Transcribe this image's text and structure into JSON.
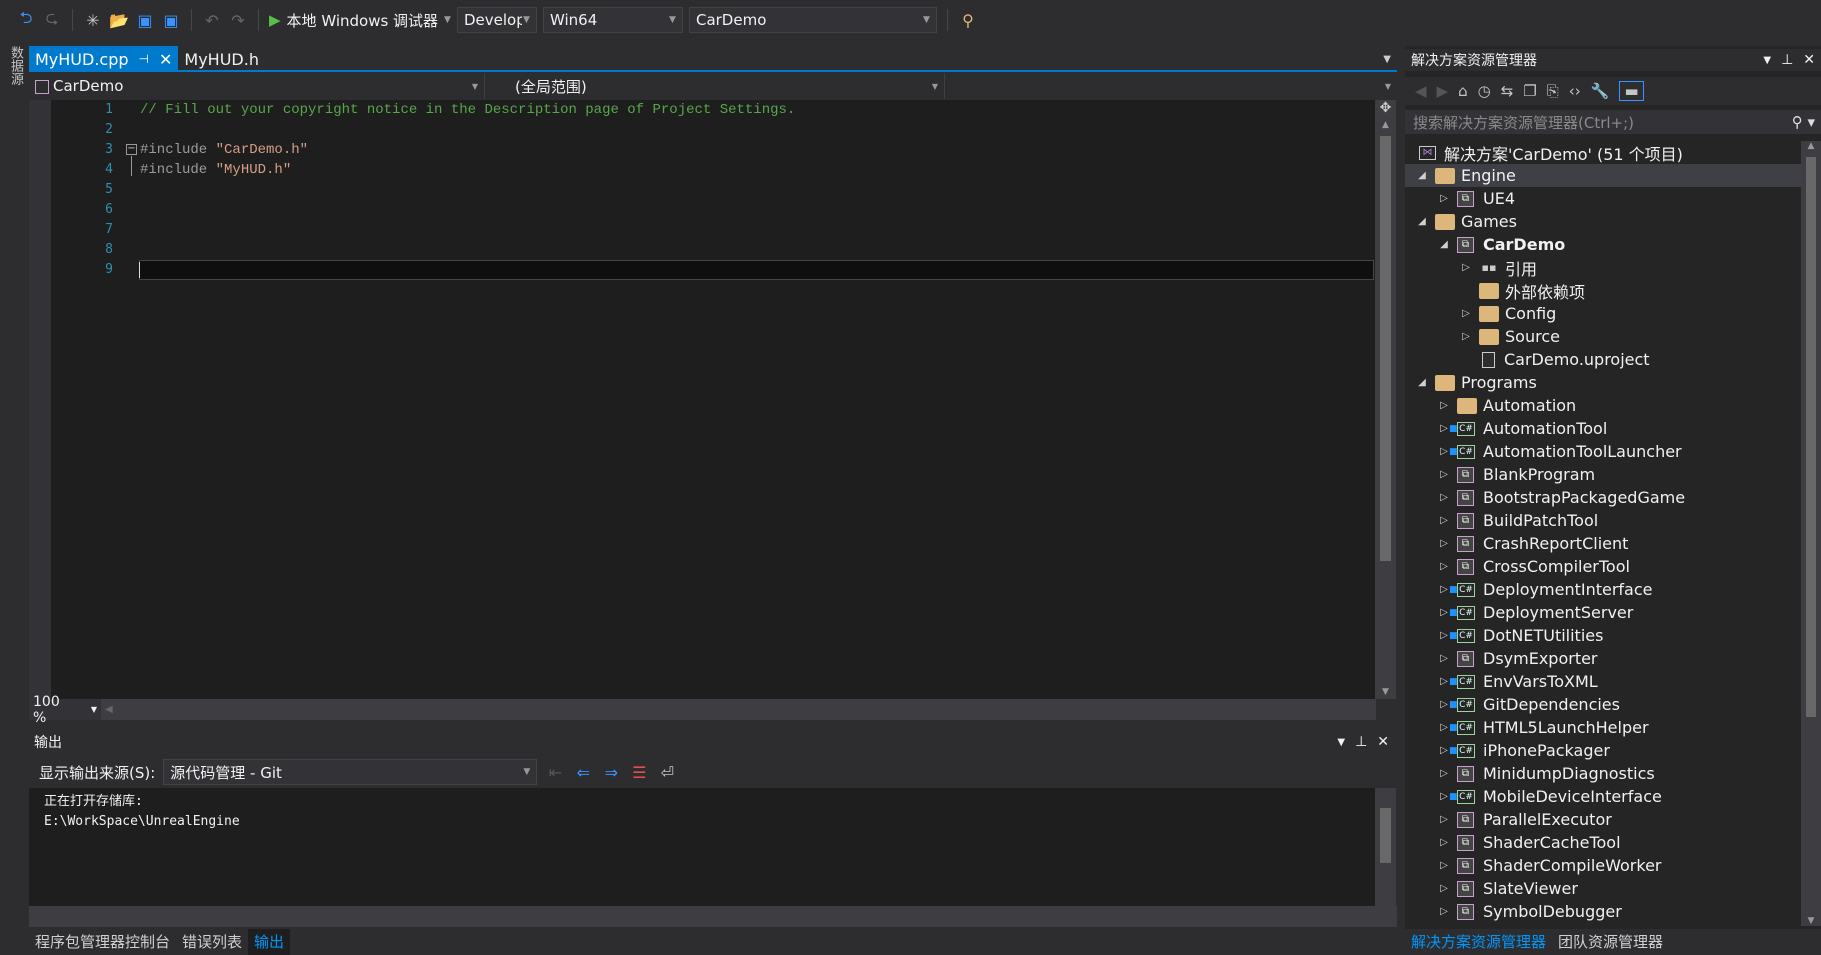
{
  "toolbar": {
    "debugger": "本地 Windows 调试器",
    "config": "Develop",
    "platform": "Win64",
    "project": "CarDemo"
  },
  "side_strip": {
    "label": "数据源"
  },
  "tabs": [
    {
      "label": "MyHUD.cpp",
      "active": true
    },
    {
      "label": "MyHUD.h",
      "active": false
    }
  ],
  "navbar": {
    "project": "CarDemo",
    "scope": "(全局范围)"
  },
  "editor": {
    "line_numbers": [
      "1",
      "2",
      "3",
      "4",
      "5",
      "6",
      "7",
      "8",
      "9"
    ],
    "lines": [
      {
        "type": "comment",
        "text": "// Fill out your copyright notice in the Description page of Project Settings."
      },
      {
        "type": "blank",
        "text": ""
      },
      {
        "type": "include",
        "directive": "#include",
        "file": "\"CarDemo.h\""
      },
      {
        "type": "include",
        "directive": "#include",
        "file": "\"MyHUD.h\""
      }
    ],
    "zoom": "100 %",
    "current_line": 9
  },
  "output": {
    "title": "输出",
    "source_label": "显示输出来源(S):",
    "source_value": "源代码管理 - Git",
    "lines": [
      "正在打开存储库:",
      "E:\\WorkSpace\\UnrealEngine"
    ]
  },
  "bottom_tabs": [
    {
      "label": "程序包管理器控制台"
    },
    {
      "label": "错误列表"
    },
    {
      "label": "输出",
      "active": true
    }
  ],
  "solution_explorer": {
    "title": "解决方案资源管理器",
    "search_placeholder": "搜索解决方案资源管理器(Ctrl+;)",
    "solution": "解决方案'CarDemo' (51 个项目)",
    "items": [
      {
        "label": "Engine",
        "level": 0,
        "expander": "open",
        "icon": "folder",
        "selected": true
      },
      {
        "label": "UE4",
        "level": 1,
        "expander": "closed",
        "icon": "project"
      },
      {
        "label": "Games",
        "level": 0,
        "expander": "open",
        "icon": "folder"
      },
      {
        "label": "CarDemo",
        "level": 1,
        "expander": "open",
        "icon": "project",
        "bold": true
      },
      {
        "label": "引用",
        "level": 2,
        "expander": "closed",
        "icon": "references"
      },
      {
        "label": "外部依赖项",
        "level": 2,
        "expander": "none",
        "icon": "folder"
      },
      {
        "label": "Config",
        "level": 2,
        "expander": "closed",
        "icon": "folder"
      },
      {
        "label": "Source",
        "level": 2,
        "expander": "closed",
        "icon": "folder"
      },
      {
        "label": "CarDemo.uproject",
        "level": 2,
        "expander": "none",
        "icon": "file"
      },
      {
        "label": "Programs",
        "level": 0,
        "expander": "open",
        "icon": "folder"
      },
      {
        "label": "Automation",
        "level": 1,
        "expander": "closed",
        "icon": "folder"
      },
      {
        "label": "AutomationTool",
        "level": 1,
        "expander": "closed",
        "icon": "csharp"
      },
      {
        "label": "AutomationToolLauncher",
        "level": 1,
        "expander": "closed",
        "icon": "csharp"
      },
      {
        "label": "BlankProgram",
        "level": 1,
        "expander": "closed",
        "icon": "project"
      },
      {
        "label": "BootstrapPackagedGame",
        "level": 1,
        "expander": "closed",
        "icon": "project"
      },
      {
        "label": "BuildPatchTool",
        "level": 1,
        "expander": "closed",
        "icon": "project"
      },
      {
        "label": "CrashReportClient",
        "level": 1,
        "expander": "closed",
        "icon": "project"
      },
      {
        "label": "CrossCompilerTool",
        "level": 1,
        "expander": "closed",
        "icon": "project"
      },
      {
        "label": "DeploymentInterface",
        "level": 1,
        "expander": "closed",
        "icon": "csharp"
      },
      {
        "label": "DeploymentServer",
        "level": 1,
        "expander": "closed",
        "icon": "csharp"
      },
      {
        "label": "DotNETUtilities",
        "level": 1,
        "expander": "closed",
        "icon": "csharp"
      },
      {
        "label": "DsymExporter",
        "level": 1,
        "expander": "closed",
        "icon": "project"
      },
      {
        "label": "EnvVarsToXML",
        "level": 1,
        "expander": "closed",
        "icon": "csharp"
      },
      {
        "label": "GitDependencies",
        "level": 1,
        "expander": "closed",
        "icon": "csharp"
      },
      {
        "label": "HTML5LaunchHelper",
        "level": 1,
        "expander": "closed",
        "icon": "csharp"
      },
      {
        "label": "iPhonePackager",
        "level": 1,
        "expander": "closed",
        "icon": "csharp"
      },
      {
        "label": "MinidumpDiagnostics",
        "level": 1,
        "expander": "closed",
        "icon": "project"
      },
      {
        "label": "MobileDeviceInterface",
        "level": 1,
        "expander": "closed",
        "icon": "csharp"
      },
      {
        "label": "ParallelExecutor",
        "level": 1,
        "expander": "closed",
        "icon": "project"
      },
      {
        "label": "ShaderCacheTool",
        "level": 1,
        "expander": "closed",
        "icon": "project"
      },
      {
        "label": "ShaderCompileWorker",
        "level": 1,
        "expander": "closed",
        "icon": "project"
      },
      {
        "label": "SlateViewer",
        "level": 1,
        "expander": "closed",
        "icon": "project"
      },
      {
        "label": "SymbolDebugger",
        "level": 1,
        "expander": "closed",
        "icon": "project"
      }
    ],
    "bottom_tabs": [
      {
        "label": "解决方案资源管理器",
        "active": true
      },
      {
        "label": "团队资源管理器"
      }
    ]
  }
}
